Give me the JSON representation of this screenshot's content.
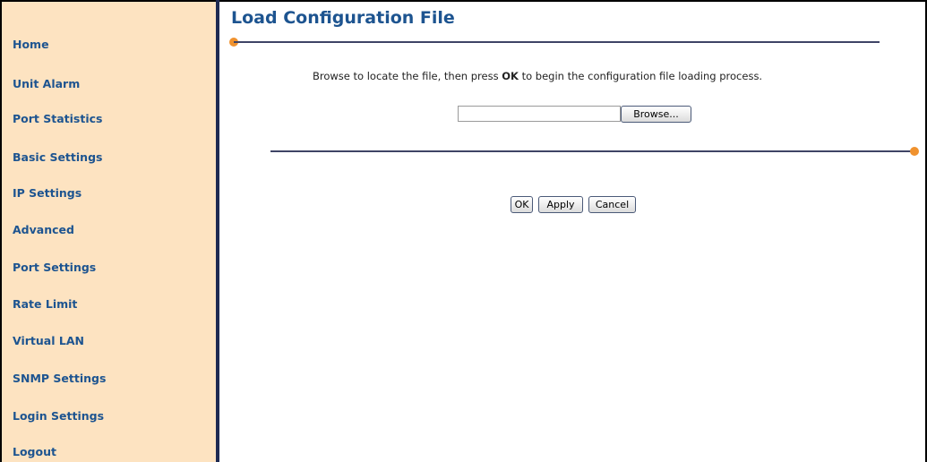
{
  "sidebar": {
    "items": [
      {
        "label": "Home"
      },
      {
        "label": "Unit Alarm"
      },
      {
        "label": "Port Statistics"
      },
      {
        "label": "Basic Settings"
      },
      {
        "label": "IP Settings"
      },
      {
        "label": "Advanced"
      },
      {
        "label": "Port Settings"
      },
      {
        "label": "Rate Limit"
      },
      {
        "label": "Virtual LAN"
      },
      {
        "label": "SNMP Settings"
      },
      {
        "label": "Login Settings"
      },
      {
        "label": "Logout"
      }
    ]
  },
  "main": {
    "title": "Load Configuration File",
    "instruction_before": "Browse to locate the file, then press ",
    "instruction_bold": "OK",
    "instruction_after": " to begin the configuration file loading process.",
    "file_input": {
      "value": ""
    },
    "browse_label": "Browse...",
    "buttons": {
      "ok": "OK",
      "apply": "Apply",
      "cancel": "Cancel"
    }
  },
  "colors": {
    "sidebar_bg": "#fde3c1",
    "nav_text": "#1d5490",
    "divider": "#1e2a52",
    "accent_dot": "#f0922e"
  }
}
